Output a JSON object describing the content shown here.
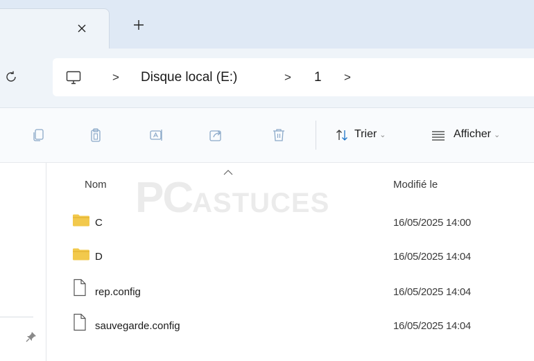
{
  "tabs": {
    "close_glyph": "×",
    "new_glyph": "+"
  },
  "address": {
    "crumbs": [
      "Disque local (E:)",
      "1"
    ]
  },
  "commands": {
    "sort_label": "Trier",
    "view_label": "Afficher"
  },
  "columns": {
    "name": "Nom",
    "modified": "Modifié le"
  },
  "files": [
    {
      "name": "C",
      "date": "16/05/2025 14:00",
      "type": "folder"
    },
    {
      "name": "D",
      "date": "16/05/2025 14:04",
      "type": "folder"
    },
    {
      "name": "rep.config",
      "date": "16/05/2025 14:04",
      "type": "file"
    },
    {
      "name": "sauvegarde.config",
      "date": "16/05/2025 14:04",
      "type": "file"
    }
  ],
  "watermark": {
    "pc": "PC",
    "astuces": "ASTUCES"
  },
  "colors": {
    "folder": "#f2c94c",
    "tabstrip": "#dfe9f5",
    "addressbar": "#eff4f9"
  }
}
